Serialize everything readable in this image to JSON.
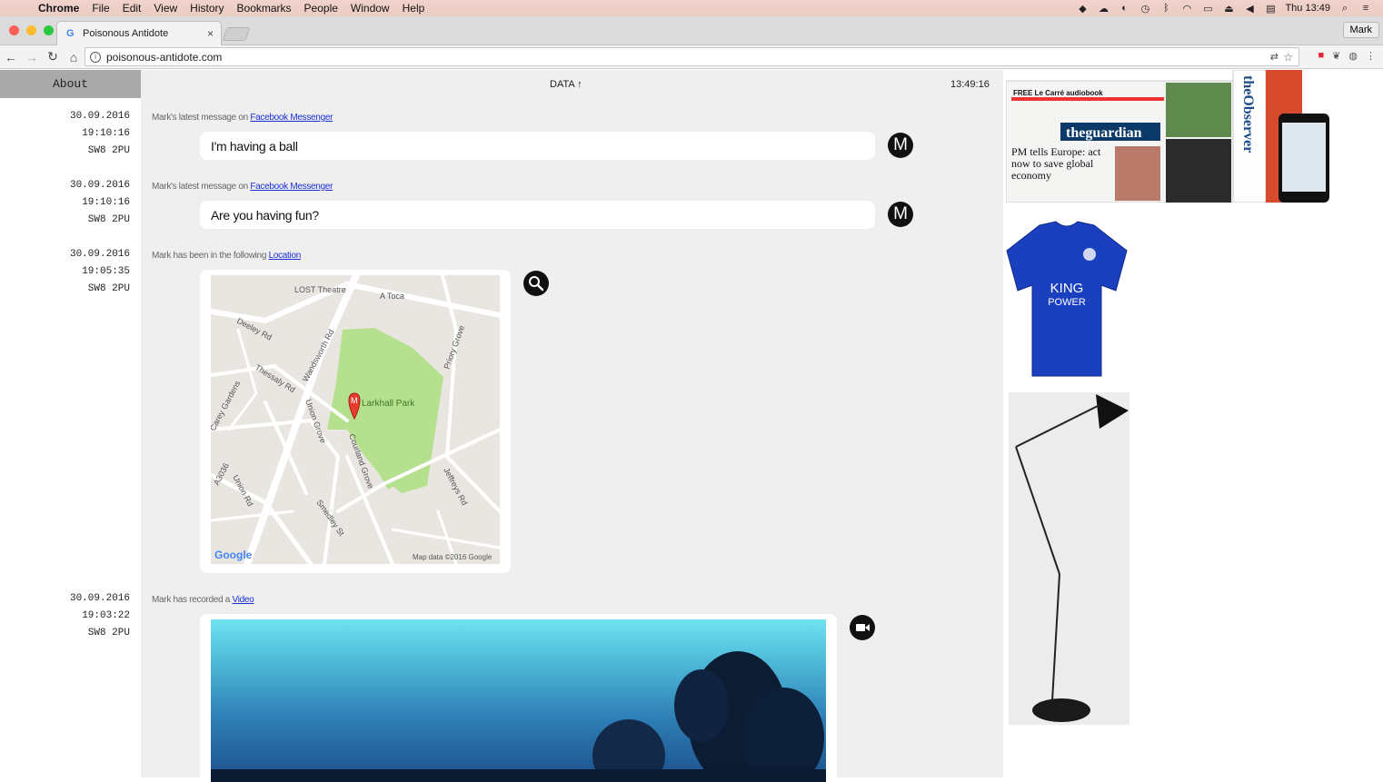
{
  "menubar": {
    "app": "Chrome",
    "items": [
      "File",
      "Edit",
      "View",
      "History",
      "Bookmarks",
      "People",
      "Window",
      "Help"
    ],
    "clock": "Thu 13:49"
  },
  "browser": {
    "tab_title": "Poisonous Antidote",
    "tab_close": "×",
    "profile": "Mark",
    "url": "poisonous-antidote.com"
  },
  "page": {
    "about": "About",
    "header_label": "DATA ↑",
    "header_time": "13:49:16"
  },
  "feed": [
    {
      "date": "30.09.2016",
      "time": "19:10:16",
      "postcode": "SW8 2PU",
      "caption_prefix": "Mark's latest message on ",
      "caption_link": "Facebook Messenger",
      "message": "I'm having a ball",
      "avatar": "M"
    },
    {
      "date": "30.09.2016",
      "time": "19:10:16",
      "postcode": "SW8 2PU",
      "caption_prefix": "Mark's latest message on ",
      "caption_link": "Facebook Messenger",
      "message": "Are you having fun?",
      "avatar": "M"
    },
    {
      "date": "30.09.2016",
      "time": "19:05:35",
      "postcode": "SW8 2PU",
      "caption_prefix": "Mark has been in the following ",
      "caption_link": "Location"
    },
    {
      "date": "30.09.2016",
      "time": "19:03:22",
      "postcode": "SW8 2PU",
      "caption_prefix": "Mark has recorded a ",
      "caption_link": "Video"
    }
  ],
  "map": {
    "labels": {
      "lost": "LOST Theatre",
      "toca": "A Toca",
      "deeley": "Deeley Rd",
      "wandsworth": "Wandsworth Rd",
      "thessaly": "Thessaly Rd",
      "priory": "Priory Grove",
      "carey": "Carey Gardens",
      "park": "Larkhall Park",
      "union_grove": "Union Grove",
      "courland": "Courland Grove",
      "a3036": "A3036",
      "union_rd": "Union Rd",
      "jeffreys": "Jeffreys Rd",
      "smedley": "Smedley St",
      "logo": "Google",
      "attribution": "Map data ©2016 Google",
      "pin": "M"
    },
    "park_color": "#b5e08d"
  },
  "right": {
    "news_masthead": "theguardian",
    "news_headline": "PM tells Europe: act now to save global economy",
    "news_observer": "theObserver",
    "news_free": "FREE Le Carré audiobook",
    "shirt_text_1": "KING",
    "shirt_text_2": "POWER"
  }
}
